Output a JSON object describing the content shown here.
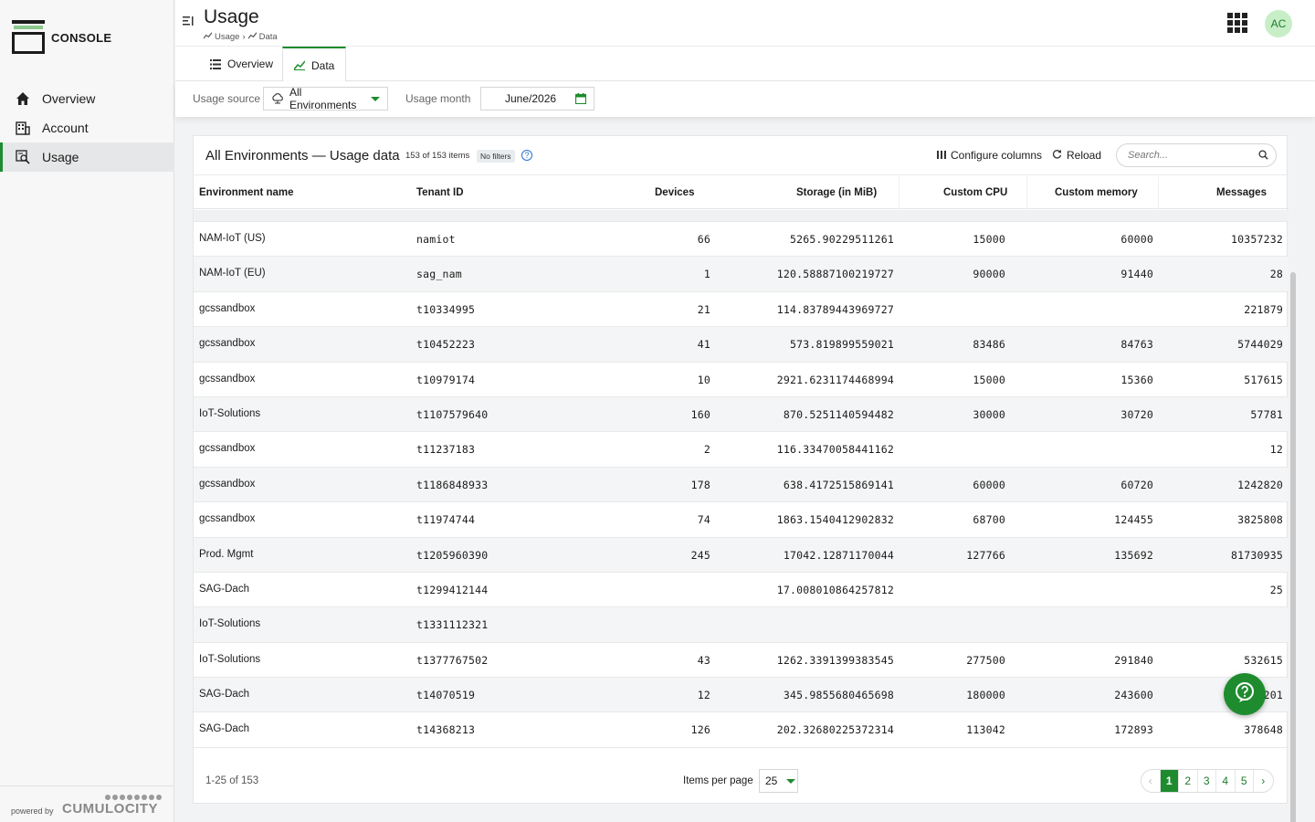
{
  "app": {
    "title": "CONSOLE",
    "powered_by": "powered by",
    "powered_brand": "CUMULOCITY"
  },
  "nav": [
    {
      "label": "Overview",
      "icon": "home-icon"
    },
    {
      "label": "Account",
      "icon": "building-icon"
    },
    {
      "label": "Usage",
      "icon": "usage-report-icon",
      "active": true
    }
  ],
  "header": {
    "title": "Usage",
    "breadcrumb": [
      "Usage",
      "Data"
    ],
    "avatar": "AC"
  },
  "tabs": [
    {
      "label": "Overview",
      "icon": "list-icon"
    },
    {
      "label": "Data",
      "icon": "line-chart-icon",
      "active": true
    }
  ],
  "filters": {
    "source_label": "Usage source",
    "source_value": "All Environments",
    "month_label": "Usage month",
    "month_value": "June/2026"
  },
  "table": {
    "title": "All Environments — Usage data",
    "count": "153 of 153 items",
    "filter_badge": "No filters",
    "configure": "Configure columns",
    "reload": "Reload",
    "search_placeholder": "Search...",
    "columns": [
      "Environment name",
      "Tenant ID",
      "Devices",
      "Storage (in MiB)",
      "Custom CPU",
      "Custom memory",
      "Messages"
    ],
    "rows": [
      [
        "NAM-IoT (US)",
        "namiot",
        "66",
        "5265.90229511261",
        "15000",
        "60000",
        "10357232"
      ],
      [
        "NAM-IoT (EU)",
        "sag_nam",
        "1",
        "120.58887100219727",
        "90000",
        "91440",
        "28"
      ],
      [
        "gcssandbox",
        "t10334995",
        "21",
        "114.83789443969727",
        "",
        "",
        "221879"
      ],
      [
        "gcssandbox",
        "t10452223",
        "41",
        "573.819899559021",
        "83486",
        "84763",
        "5744029"
      ],
      [
        "gcssandbox",
        "t10979174",
        "10",
        "2921.6231174468994",
        "15000",
        "15360",
        "517615"
      ],
      [
        "IoT-Solutions",
        "t1107579640",
        "160",
        "870.5251140594482",
        "30000",
        "30720",
        "57781"
      ],
      [
        "gcssandbox",
        "t11237183",
        "2",
        "116.33470058441162",
        "",
        "",
        "12"
      ],
      [
        "gcssandbox",
        "t1186848933",
        "178",
        "638.4172515869141",
        "60000",
        "60720",
        "1242820"
      ],
      [
        "gcssandbox",
        "t11974744",
        "74",
        "1863.1540412902832",
        "68700",
        "124455",
        "3825808"
      ],
      [
        "Prod. Mgmt",
        "t1205960390",
        "245",
        "17042.12871170044",
        "127766",
        "135692",
        "81730935"
      ],
      [
        "SAG-Dach",
        "t1299412144",
        "",
        "17.008010864257812",
        "",
        "",
        "25"
      ],
      [
        "IoT-Solutions",
        "t1331112321",
        "",
        "",
        "",
        "",
        ""
      ],
      [
        "IoT-Solutions",
        "t1377767502",
        "43",
        "1262.3391399383545",
        "277500",
        "291840",
        "532615"
      ],
      [
        "SAG-Dach",
        "t14070519",
        "12",
        "345.9855680465698",
        "180000",
        "243600",
        "201"
      ],
      [
        "SAG-Dach",
        "t14368213",
        "126",
        "202.32680225372314",
        "113042",
        "172893",
        "378648"
      ]
    ],
    "range": "1-25 of 153",
    "items_per_page_label": "Items per page",
    "items_per_page": "25",
    "pages": [
      "1",
      "2",
      "3",
      "4",
      "5"
    ],
    "current_page": "1",
    "prev": "‹",
    "next": "›"
  },
  "colors": {
    "accent": "#1e8c2e",
    "avatar_bg": "#c8eec8"
  }
}
